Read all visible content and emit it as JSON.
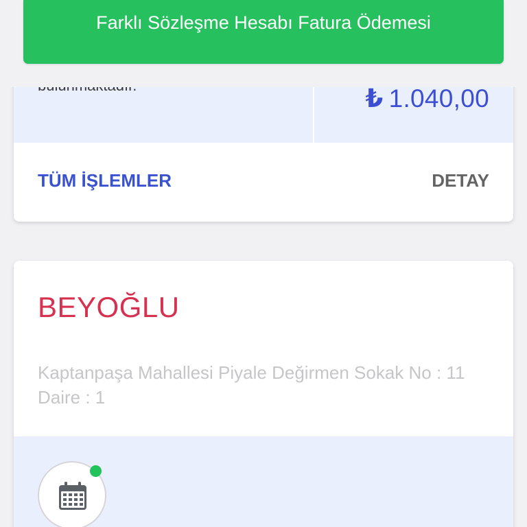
{
  "banner": {
    "title": "Farklı Sözleşme Hesabı Fatura Ödemesi"
  },
  "account_card": {
    "cut_off_text": "bulunmaktadır.",
    "amount_currency": "₺",
    "amount_value": "1.040,00",
    "actions": {
      "all_transactions": "TÜM İŞLEMLER",
      "detail": "DETAY"
    }
  },
  "address_card": {
    "district": "BEYOĞLU",
    "address": "Kaptanpaşa Mahallesi Piyale Değirmen Sokak No : 11 Daire : 1",
    "icon": "calendar-icon",
    "status_dot_color": "#22c35a"
  },
  "colors": {
    "banner_green": "#26c15e",
    "accent_blue": "#3a52cf",
    "district_red": "#d6314f",
    "band_lavender": "#eaeffd"
  }
}
